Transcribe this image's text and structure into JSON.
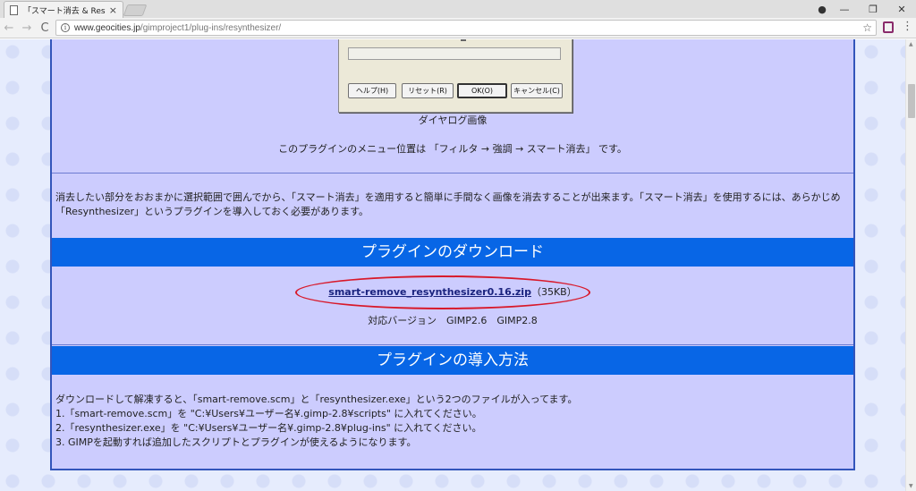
{
  "browser": {
    "tab_title": "「スマート消去 & Resynthe",
    "tab_close": "×",
    "url_host": "www.geocities.jp",
    "url_path": "/gimproject1/plug-ins/resynthesizer/",
    "nav_back": "←",
    "nav_forward": "→",
    "nav_reload": "C",
    "star": "☆",
    "profile": "●",
    "minimize": "—",
    "maximize": "❐",
    "close": "✕",
    "menu": "⋮"
  },
  "dialog": {
    "help_button": "ヘルプ(H)",
    "reset_button": "リセット(R)",
    "ok_button": "OK(O)",
    "cancel_button": "キャンセル(C)",
    "caption": "ダイヤログ画像"
  },
  "menu_location": "このプラグインのメニュー位置は 「フィルタ → 強調 → スマート消去」 です。",
  "description": {
    "line1": "消去したい部分をおおまかに選択範囲で囲んでから、「スマート消去」を適用すると簡単に手間なく画像を消去することが出来ます。「スマート消去」を使用するには、あらかじめ",
    "line2": "「Resynthesizer」というプラグインを導入しておく必要があります。"
  },
  "download_section": {
    "heading": "プラグインのダウンロード",
    "link_text": "smart-remove_resynthesizer0.16.zip",
    "size": "（35KB）",
    "versions": "対応バージョン　GIMP2.6　GIMP2.8"
  },
  "install_section": {
    "heading": "プラグインの導入方法",
    "intro": "ダウンロードして解凍すると、「smart-remove.scm」と「resynthesizer.exe」という2つのファイルが入ってます。",
    "steps": [
      "1.「smart-remove.scm」を \"C:¥Users¥ユーザー名¥.gimp-2.8¥scripts\" に入れてください。",
      "2.「resynthesizer.exe」を \"C:¥Users¥ユーザー名¥.gimp-2.8¥plug-ins\" に入れてください。",
      "3. GIMPを起動すれば追加したスクリプトとプラグインが使えるようになります。"
    ]
  },
  "colors": {
    "heading_bar": "#0866e6",
    "content_bg": "#ccccfe",
    "annotation_ellipse": "#d8192a"
  }
}
